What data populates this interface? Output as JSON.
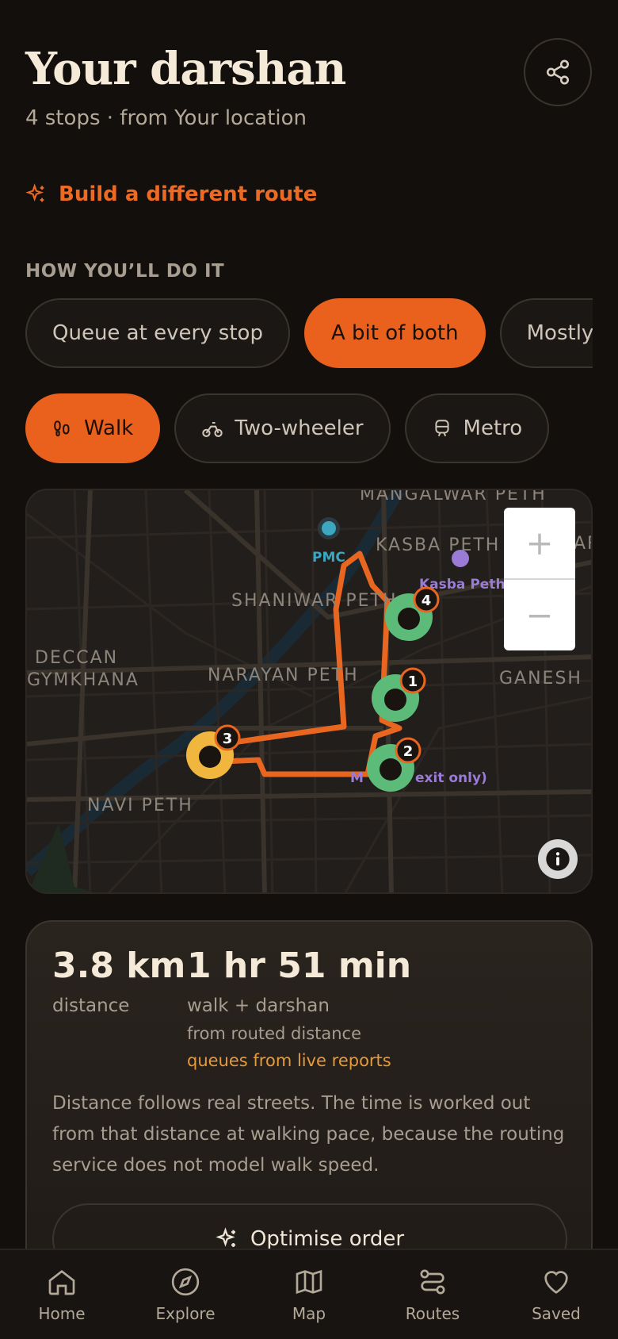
{
  "header": {
    "title": "Your darshan",
    "subtitle": "4 stops · from Your location"
  },
  "rebuild": {
    "label": "Build a different route"
  },
  "section": {
    "label": "HOW YOU’LL DO IT"
  },
  "queue_modes": [
    {
      "label": "Queue at every stop",
      "active": false
    },
    {
      "label": "A bit of both",
      "active": true
    },
    {
      "label": "Mostly fro",
      "active": false
    }
  ],
  "travel_modes": [
    {
      "label": "Walk",
      "active": true
    },
    {
      "label": "Two-wheeler",
      "active": false
    },
    {
      "label": "Metro",
      "active": false
    }
  ],
  "map": {
    "areas": [
      "MANGALWAR PETH",
      "KASBA PETH",
      "SHANIWAR PETH",
      "NARAYAN PETH",
      "DECCAN",
      "GYMKHANA",
      "GANESH P",
      "NAVI PETH",
      "AR"
    ],
    "pois": [
      "PMC",
      "Kasba Peth",
      "M",
      "exit only)"
    ],
    "zoom_in": "+",
    "zoom_out": "−",
    "stops": [
      "1",
      "2",
      "3",
      "4"
    ]
  },
  "stats": {
    "distance_value": "3.8 km",
    "distance_label": "distance",
    "time_value": "1 hr 51 min",
    "time_label": "walk + darshan",
    "time_note": "from routed distance",
    "queue_note": "queues from live reports",
    "explanation": "Distance follows real streets. The time is worked out from that distance at walking pace, because the routing service does not model walk speed.",
    "optimise_label": "Optimise order"
  },
  "nav": [
    {
      "label": "Home",
      "icon": "home-icon"
    },
    {
      "label": "Explore",
      "icon": "compass-icon"
    },
    {
      "label": "Map",
      "icon": "map-icon"
    },
    {
      "label": "Routes",
      "icon": "routes-icon"
    },
    {
      "label": "Saved",
      "icon": "heart-icon"
    }
  ],
  "colors": {
    "accent": "#e9611d",
    "background": "#130f0c",
    "stop_green": "#5dbb7a",
    "stop_yellow": "#f0b63e",
    "route": "#e8661f"
  }
}
